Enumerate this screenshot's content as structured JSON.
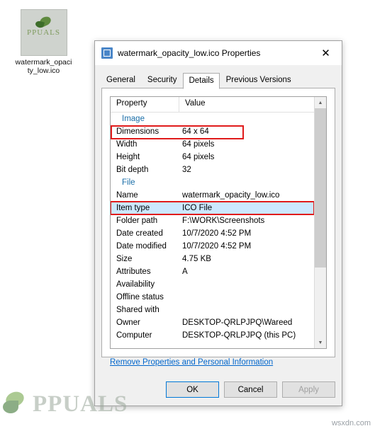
{
  "desktop": {
    "icon": {
      "name": "watermark_opacity_low.ico",
      "label": "watermark_opaci\nty_low.ico",
      "icon_semantic": "appuals-leaf-icon"
    }
  },
  "watermark": {
    "brand": "PPUALS",
    "site": "wsxdn.com"
  },
  "dialog": {
    "title": "watermark_opacity_low.ico Properties",
    "title_icon": "file-properties-icon",
    "close_icon": "close-icon",
    "tabs": [
      {
        "label": "General",
        "active": false
      },
      {
        "label": "Security",
        "active": false
      },
      {
        "label": "Details",
        "active": true
      },
      {
        "label": "Previous Versions",
        "active": false
      }
    ],
    "columns": {
      "property": "Property",
      "value": "Value"
    },
    "groups": [
      {
        "title": "Image",
        "rows": [
          {
            "name": "Dimensions",
            "value": "64 x 64",
            "highlight": "red",
            "selected": false
          },
          {
            "name": "Width",
            "value": "64 pixels",
            "highlight": "none",
            "selected": false
          },
          {
            "name": "Height",
            "value": "64 pixels",
            "highlight": "none",
            "selected": false
          },
          {
            "name": "Bit depth",
            "value": "32",
            "highlight": "none",
            "selected": false
          }
        ]
      },
      {
        "title": "File",
        "rows": [
          {
            "name": "Name",
            "value": "watermark_opacity_low.ico",
            "highlight": "none",
            "selected": false
          },
          {
            "name": "Item type",
            "value": "ICO File",
            "highlight": "red",
            "selected": true
          },
          {
            "name": "Folder path",
            "value": "F:\\WORK\\Screenshots",
            "highlight": "none",
            "selected": false
          },
          {
            "name": "Date created",
            "value": "10/7/2020 4:52 PM",
            "highlight": "none",
            "selected": false
          },
          {
            "name": "Date modified",
            "value": "10/7/2020 4:52 PM",
            "highlight": "none",
            "selected": false
          },
          {
            "name": "Size",
            "value": "4.75 KB",
            "highlight": "none",
            "selected": false
          },
          {
            "name": "Attributes",
            "value": "A",
            "highlight": "none",
            "selected": false
          },
          {
            "name": "Availability",
            "value": "",
            "highlight": "none",
            "selected": false
          },
          {
            "name": "Offline status",
            "value": "",
            "highlight": "none",
            "selected": false
          },
          {
            "name": "Shared with",
            "value": "",
            "highlight": "none",
            "selected": false
          },
          {
            "name": "Owner",
            "value": "DESKTOP-QRLPJPQ\\Wareed",
            "highlight": "none",
            "selected": false
          },
          {
            "name": "Computer",
            "value": "DESKTOP-QRLPJPQ (this PC)",
            "highlight": "none",
            "selected": false
          }
        ]
      }
    ],
    "remove_properties_link": "Remove Properties and Personal Information",
    "buttons": {
      "ok": "OK",
      "cancel": "Cancel",
      "apply": "Apply"
    },
    "scrollbar": {
      "up_icon": "chevron-up-icon",
      "down_icon": "chevron-down-icon"
    }
  }
}
